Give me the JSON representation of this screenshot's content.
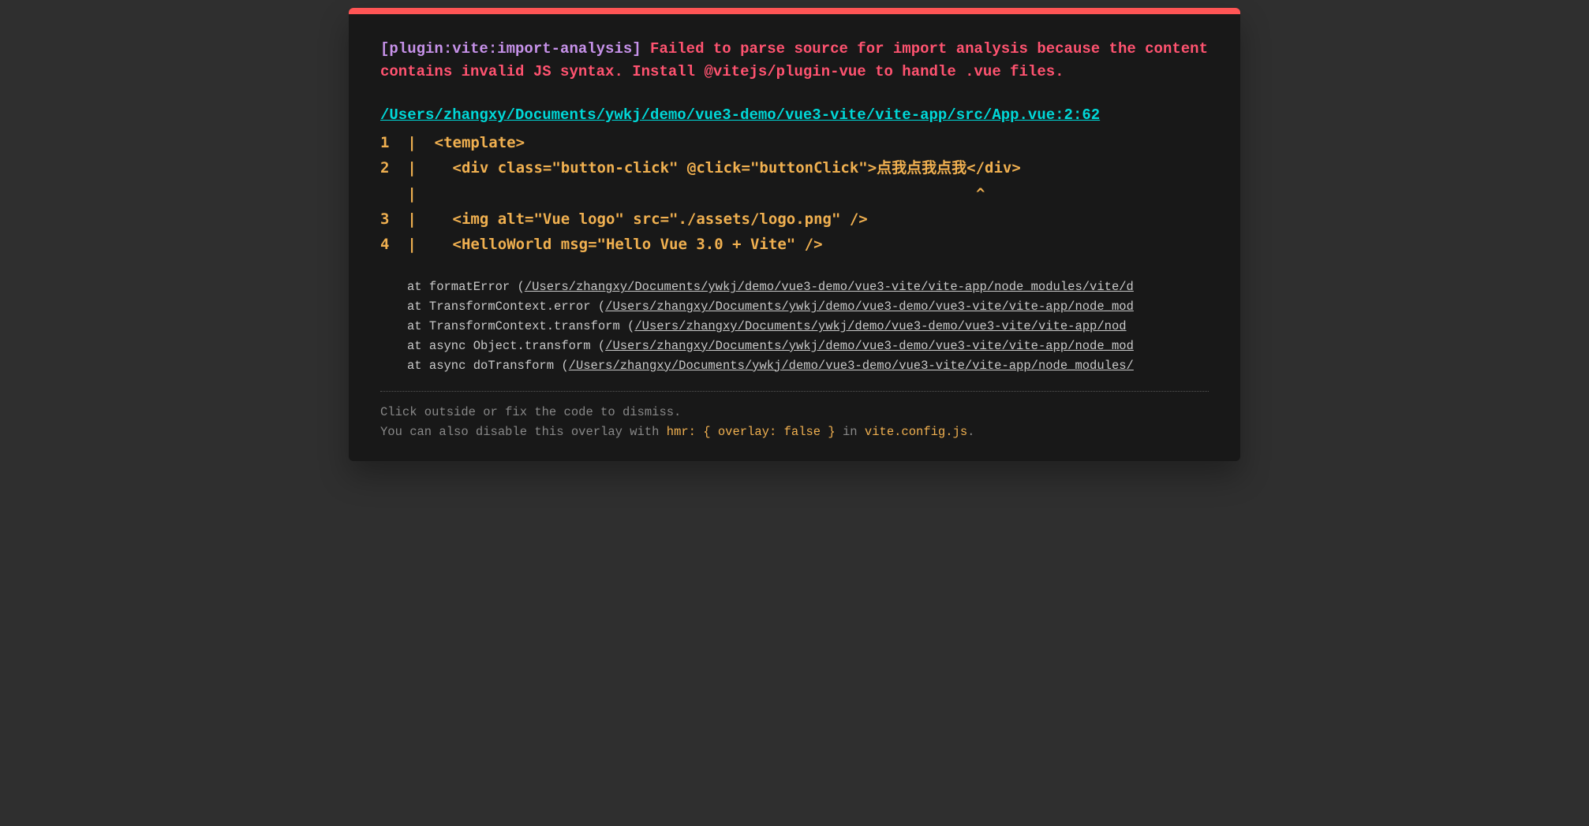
{
  "error": {
    "plugin_tag": "[plugin:vite:import-analysis]",
    "message": " Failed to parse source for import analysis because the content contains invalid JS syntax. Install @vitejs/plugin-vue to handle .vue files."
  },
  "file_link": "/Users/zhangxy/Documents/ywkj/demo/vue3-demo/vue3-vite/vite-app/src/App.vue:2:62",
  "code": "1  |  <template>\n2  |    <div class=\"button-click\" @click=\"buttonClick\">点我点我点我</div>\n   |                                                              ^\n3  |    <img alt=\"Vue logo\" src=\"./assets/logo.png\" />\n4  |    <HelloWorld msg=\"Hello Vue 3.0 + Vite\" />",
  "stack": [
    {
      "prefix": "at formatError (",
      "path": "/Users/zhangxy/Documents/ywkj/demo/vue3-demo/vue3-vite/vite-app/node_modules/vite/d"
    },
    {
      "prefix": "at TransformContext.error (",
      "path": "/Users/zhangxy/Documents/ywkj/demo/vue3-demo/vue3-vite/vite-app/node_mod"
    },
    {
      "prefix": "at TransformContext.transform (",
      "path": "/Users/zhangxy/Documents/ywkj/demo/vue3-demo/vue3-vite/vite-app/nod"
    },
    {
      "prefix": "at async Object.transform (",
      "path": "/Users/zhangxy/Documents/ywkj/demo/vue3-demo/vue3-vite/vite-app/node_mod"
    },
    {
      "prefix": "at async doTransform (",
      "path": "/Users/zhangxy/Documents/ywkj/demo/vue3-demo/vue3-vite/vite-app/node_modules/"
    }
  ],
  "tip": {
    "line1": "Click outside or fix the code to dismiss.",
    "line2_prefix": "You can also disable this overlay with ",
    "line2_code": "hmr: { overlay: false }",
    "line2_mid": " in ",
    "line2_file": "vite.config.js",
    "line2_suffix": "."
  }
}
